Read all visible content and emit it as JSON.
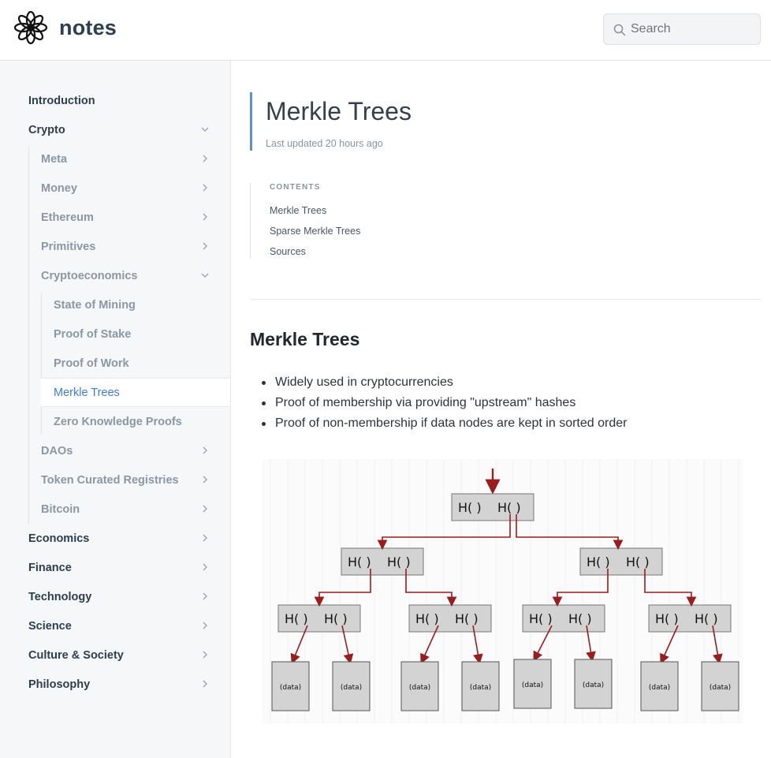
{
  "header": {
    "site_title": "notes",
    "logo_icon": "flower-mandala-icon",
    "search": {
      "placeholder": "Search",
      "icon": "search-icon"
    }
  },
  "sidebar": {
    "items": [
      {
        "label": "Introduction",
        "level": 0,
        "chevron": "none"
      },
      {
        "label": "Crypto",
        "level": 0,
        "chevron": "down"
      },
      {
        "label": "Meta",
        "level": 1,
        "chevron": "right"
      },
      {
        "label": "Money",
        "level": 1,
        "chevron": "right"
      },
      {
        "label": "Ethereum",
        "level": 1,
        "chevron": "right"
      },
      {
        "label": "Primitives",
        "level": 1,
        "chevron": "right"
      },
      {
        "label": "Cryptoeconomics",
        "level": 1,
        "chevron": "down"
      },
      {
        "label": "State of Mining",
        "level": 2,
        "chevron": "none"
      },
      {
        "label": "Proof of Stake",
        "level": 2,
        "chevron": "none"
      },
      {
        "label": "Proof of Work",
        "level": 2,
        "chevron": "none"
      },
      {
        "label": "Merkle Trees",
        "level": 2,
        "chevron": "none",
        "active": true
      },
      {
        "label": "Zero Knowledge Proofs",
        "level": 2,
        "chevron": "none"
      },
      {
        "label": "DAOs",
        "level": 1,
        "chevron": "right"
      },
      {
        "label": "Token Curated Registries",
        "level": 1,
        "chevron": "right"
      },
      {
        "label": "Bitcoin",
        "level": 1,
        "chevron": "right"
      },
      {
        "label": "Economics",
        "level": 0,
        "chevron": "right"
      },
      {
        "label": "Finance",
        "level": 0,
        "chevron": "right"
      },
      {
        "label": "Technology",
        "level": 0,
        "chevron": "right"
      },
      {
        "label": "Science",
        "level": 0,
        "chevron": "right"
      },
      {
        "label": "Culture & Society",
        "level": 0,
        "chevron": "right"
      },
      {
        "label": "Philosophy",
        "level": 0,
        "chevron": "right"
      }
    ]
  },
  "page": {
    "title": "Merkle Trees",
    "last_updated": "Last updated 20 hours ago",
    "toc": {
      "heading": "CONTENTS",
      "links": [
        "Merkle Trees",
        "Sparse Merkle Trees",
        "Sources"
      ]
    },
    "section": {
      "title": "Merkle Trees",
      "bullets": [
        "Widely used in cryptocurrencies",
        "Proof of membership via providing \"upstream\" hashes",
        "Proof of non-membership if data nodes are kept in sorted order"
      ]
    },
    "diagram": {
      "hash_left": "H(",
      "hash_right": ")",
      "data_label": "(data)"
    }
  },
  "colors": {
    "accent": "#3d7ce0",
    "title_bar": "#5b8fd6",
    "arrow": "#9b1c1c",
    "node_fill": "#d3d3d3",
    "sidebar_bg": "#f6f7f8"
  }
}
